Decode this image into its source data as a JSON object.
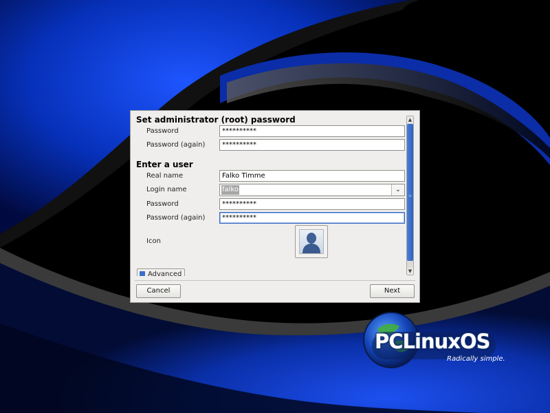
{
  "root_section": {
    "title": "Set administrator (root) password",
    "password_label": "Password",
    "password_value": "**********",
    "password_again_label": "Password (again)",
    "password_again_value": "**********"
  },
  "user_section": {
    "title": "Enter a user",
    "real_name_label": "Real name",
    "real_name_value": "Falko Timme",
    "login_name_label": "Login name",
    "login_name_value": "falko",
    "password_label": "Password",
    "password_value": "**********",
    "password_again_label": "Password (again)",
    "password_again_value": "**********",
    "icon_label": "Icon"
  },
  "advanced_label": "Advanced",
  "buttons": {
    "cancel": "Cancel",
    "next": "Next"
  },
  "branding": {
    "logo_text": "PCLinuxOS",
    "tagline": "Radically simple."
  },
  "colors": {
    "accent": "#2f63bf",
    "wallpaper_blue": "#0a35c8"
  },
  "icons": {
    "user_avatar": "user-avatar-icon",
    "dropdown": "chevron-down-icon"
  }
}
